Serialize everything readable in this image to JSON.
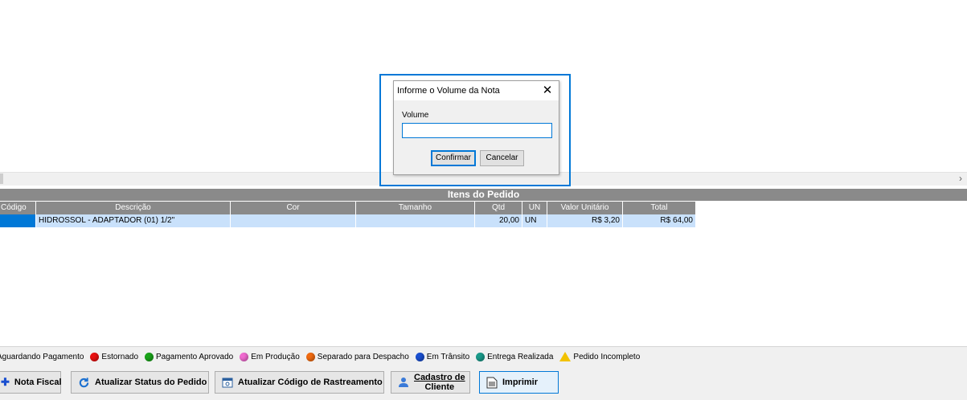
{
  "items_header": "Itens do Pedido",
  "columns": [
    "Código",
    "Descrição",
    "Cor",
    "Tamanho",
    "Qtd",
    "UN",
    "Valor Unitário",
    "Total"
  ],
  "rows": [
    {
      "codigo": "",
      "descricao": "HIDROSSOL - ADAPTADOR (01) 1/2\"",
      "cor": "",
      "tamanho": "",
      "qtd": "20,00",
      "un": "UN",
      "valor_unitario": "R$ 3,20",
      "total": "R$ 64,00"
    }
  ],
  "legend": [
    {
      "label": "Aguardando Pagamento",
      "icon": "none"
    },
    {
      "label": "Estornado",
      "icon": "red-dot-icon",
      "color": "#e81010"
    },
    {
      "label": "Pagamento Aprovado",
      "icon": "green-dot-icon",
      "color": "#19a319"
    },
    {
      "label": "Em Produção",
      "icon": "pink-dot-icon",
      "color": "#f06ad0"
    },
    {
      "label": "Separado para Despacho",
      "icon": "orange-dot-icon",
      "color": "#f06a10"
    },
    {
      "label": "Em Trânsito",
      "icon": "blue-dot-icon",
      "color": "#1a4fd0"
    },
    {
      "label": "Entrega Realizada",
      "icon": "teal-dot-icon",
      "color": "#1a9a8a"
    },
    {
      "label": "Pedido Incompleto",
      "icon": "warning-icon",
      "color": "#f2c200"
    }
  ],
  "buttons": {
    "nota_fiscal": "Nota Fiscal",
    "atualizar_status": "Atualizar Status do Pedido",
    "atualizar_codigo": "Atualizar Código de Rastreamento",
    "cadastro_line1": "Cadastro de",
    "cadastro_line2": "Cliente",
    "imprimir": "Imprimir"
  },
  "dialog": {
    "title": "Informe o Volume da Nota",
    "field_label": "Volume",
    "field_value": "",
    "confirm": "Confirmar",
    "cancel": "Cancelar"
  },
  "colors": {
    "accent": "#0078d7",
    "header_gray": "#8a8a8a",
    "row_highlight": "#c9e1fb"
  }
}
